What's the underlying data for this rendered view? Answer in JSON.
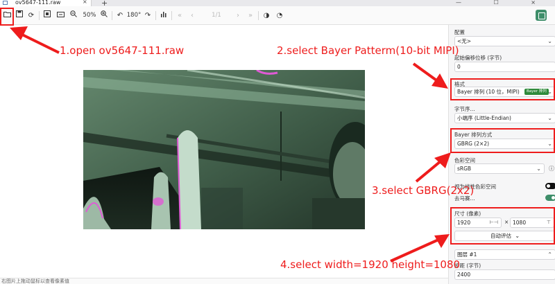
{
  "tab": {
    "title": "ov5647-111.raw",
    "close": "×",
    "new": "+"
  },
  "window": {
    "controls": "— ☐ ×"
  },
  "toolbar": {
    "zoom": "50%",
    "rotate": "180°",
    "page": "1/1",
    "icons": [
      "open-file-icon",
      "save-icon",
      "refresh-icon",
      "fit-icon",
      "frame-icon",
      "zoom-out-icon",
      "zoom-in-icon",
      "rotate-left-icon",
      "rotate-right-icon",
      "histogram-icon",
      "first-icon",
      "prev-icon",
      "next-icon",
      "last-icon",
      "contrast-icon",
      "palette-icon"
    ]
  },
  "status": {
    "text": "右图片上拖动鼠标以查看像素值"
  },
  "panel": {
    "preset_label": "配置",
    "preset_value": "<无>",
    "offset_label": "起始偏移位移 (字节)",
    "offset_value": "0",
    "format_label": "格式",
    "format_value": "Bayer 排列 (10 位，MIPI)",
    "format_badge": "Bayer 排列",
    "byteorder_label": "字节序...",
    "byteorder_value": "小端序 (Little-Endian)",
    "bayer_label": "Bayer 排列方式",
    "bayer_value": "GBRG (2×2)",
    "colorspace_label": "色彩空间",
    "colorspace_value": "sRGB",
    "linear_label": "视为线性色彩空间",
    "demosaic_label": "去马赛...",
    "size_label": "尺寸 (像素)",
    "width": "1920",
    "times": "×",
    "height": "1080",
    "auto_button": "自动评估",
    "plane_label": "图层 #1",
    "stride_label": "步距 (字节)",
    "stride_value": "2400"
  },
  "annotations": {
    "step1": "1.open ov5647-111.raw",
    "step2": "2.select Bayer Patterm(10-bit MIPI)",
    "step3": "3.select GBRG(2x2)",
    "step4": "4.select width=1920 height=1080"
  },
  "colors": {
    "accent": "#3e8e6a",
    "annotation": "#ee1c1c",
    "badge": "#2f8a3b"
  }
}
